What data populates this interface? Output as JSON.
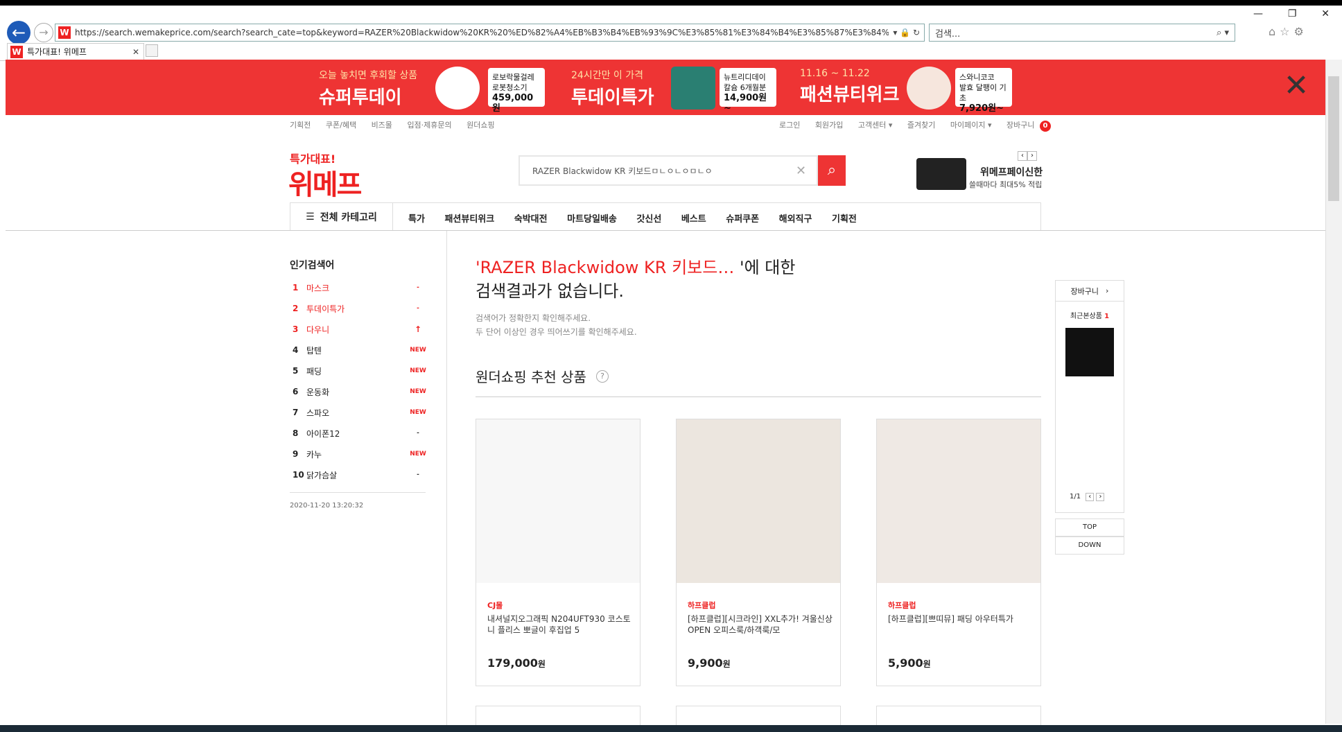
{
  "browser": {
    "url": "https://search.wemakeprice.com/search?search_cate=top&keyword=RAZER%20Blackwidow%20KR%20%ED%82%A4%EB%B3%B4%EB%93%9C%E3%85%81%E3%84%B4%E3%85%87%E3%84%B4%E3%85%87%E3%85'",
    "search_placeholder": "검색...",
    "tab_title": "특가대표! 위메프",
    "favicon": "W"
  },
  "banner": {
    "promos": [
      {
        "sub": "오늘 놓치면 후회할 상품",
        "main": "슈퍼투데이",
        "card": [
          "로보락물걸레",
          "로봇청소기"
        ],
        "price": "459,000원"
      },
      {
        "sub": "24시간만 이 가격",
        "main": "투데이특가",
        "card": [
          "뉴트리디데이",
          "칼슘 6개월분"
        ],
        "price": "14,900원~"
      },
      {
        "sub": "11.16 ~ 11.22",
        "main": "패션뷰티위크",
        "card": [
          "스와니코코",
          "발효 달팽이 기초"
        ],
        "price": "7,920원~"
      }
    ]
  },
  "header": {
    "left_links": [
      "기획전",
      "쿠폰/혜택",
      "비즈몰",
      "입점·제휴문의",
      "원더쇼핑"
    ],
    "right_links": [
      "로그인",
      "회원가입",
      "고객센터 ▾",
      "즐겨찾기",
      "마이페이지 ▾",
      "장바구니"
    ],
    "cart_count": "0",
    "logo_sub": "특가대표!",
    "logo_main": "위메프",
    "search_value": "RAZER Blackwidow KR 키보드ㅁㄴㅇㄴㅇㅁㄴㅇ",
    "card_title": "위메프페이신한",
    "card_sub": "쓸때마다 최대5% 적립"
  },
  "gnb": {
    "all_label": "전체 카테고리",
    "items": [
      "특가",
      "패션뷰티위크",
      "숙박대전",
      "마트당일배송",
      "갓신선",
      "베스트",
      "슈퍼쿠폰",
      "해외직구",
      "기획전"
    ]
  },
  "ranking": {
    "title": "인기검색어",
    "items": [
      {
        "num": "1",
        "kw": "마스크",
        "status": "-"
      },
      {
        "num": "2",
        "kw": "투데이특가",
        "status": "-"
      },
      {
        "num": "3",
        "kw": "다우니",
        "status": "↑"
      },
      {
        "num": "4",
        "kw": "탑텐",
        "status": "NEW"
      },
      {
        "num": "5",
        "kw": "패딩",
        "status": "NEW"
      },
      {
        "num": "6",
        "kw": "운동화",
        "status": "NEW"
      },
      {
        "num": "7",
        "kw": "스파오",
        "status": "NEW"
      },
      {
        "num": "8",
        "kw": "아이폰12",
        "status": "-"
      },
      {
        "num": "9",
        "kw": "카누",
        "status": "NEW"
      },
      {
        "num": "10",
        "kw": "닭가슴살",
        "status": "-"
      }
    ],
    "date": "2020-11-20 13:20:32"
  },
  "result": {
    "keyword": "'RAZER Blackwidow KR 키보드…",
    "suffix": "'에 대한",
    "line2": "검색결과가 없습니다.",
    "hint1": "검색어가 정확한지 확인해주세요.",
    "hint2": "두 단어 이상인 경우 띄어쓰기를 확인해주세요.",
    "rec_title": "원더쇼핑 추천 상품",
    "rec_help": "?"
  },
  "products": [
    {
      "seller": "CJ몰",
      "name": "내셔널지오그래픽 N204UFT930 코스토니 플리스 뽀글이 후집업 5",
      "price": "179,000",
      "unit": "원"
    },
    {
      "seller": "하프클럽",
      "name": "[하프클럽][시크라인] XXL추가! 겨울신상 OPEN 오피스룩/하객룩/모",
      "price": "9,900",
      "unit": "원"
    },
    {
      "seller": "하프클럽",
      "name": "[하프클럽][쁘띠뮤] 패딩 아우터특가",
      "price": "5,900",
      "unit": "원"
    }
  ],
  "quick": {
    "cart": "장바구니",
    "recent": "최근본상품",
    "recent_count": "1",
    "page": "1/1",
    "top": "TOP",
    "down": "DOWN"
  }
}
